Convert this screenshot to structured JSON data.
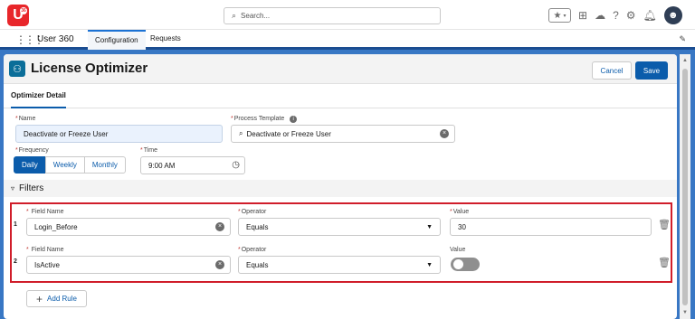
{
  "topbar": {
    "logo": "U",
    "logo_badge": "36",
    "search_placeholder": "Search...",
    "icons": [
      "star-icon",
      "chevron-down-icon",
      "add-icon",
      "cloud-icon",
      "help-icon",
      "gear-icon",
      "bell-icon",
      "avatar-icon"
    ]
  },
  "navbar": {
    "app_name": "User 360",
    "tabs": [
      {
        "label": "Configuration",
        "active": true
      },
      {
        "label": "Requests",
        "active": false
      }
    ]
  },
  "header": {
    "title": "License Optimizer",
    "cancel_label": "Cancel",
    "save_label": "Save"
  },
  "subtab": {
    "label": "Optimizer Detail"
  },
  "form": {
    "name": {
      "label": "Name",
      "required": "*",
      "value": "Deactivate or Freeze User"
    },
    "process_template": {
      "label": "Process Template",
      "required": "*",
      "value": "Deactivate or Freeze User"
    },
    "frequency": {
      "label": "Frequency",
      "required": "*",
      "options": [
        "Daily",
        "Weekly",
        "Monthly"
      ],
      "selected": "Daily"
    },
    "time": {
      "label": "Time",
      "required": "*",
      "value": "9:00 AM"
    }
  },
  "filters": {
    "section_label": "Filters",
    "rules": [
      {
        "number": "1",
        "field_label": "Field Name",
        "field_value": "Login_Before",
        "operator_label": "Operator",
        "operator_value": "Equals",
        "value_label": "Value",
        "value": "30"
      },
      {
        "number": "2",
        "field_label": "Field Name",
        "field_value": "IsActive",
        "operator_label": "Operator",
        "operator_value": "Equals",
        "value_label": "Value",
        "toggle_on": false
      }
    ],
    "add_rule_label": "Add Rule"
  },
  "colors": {
    "brand": "#0b5cab",
    "highlight": "#d01d2a",
    "background": "#3877c4"
  }
}
